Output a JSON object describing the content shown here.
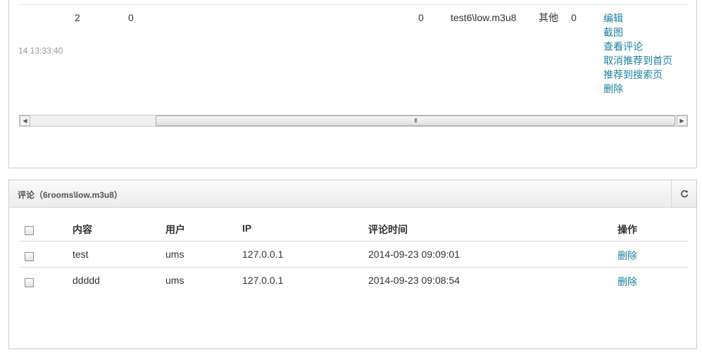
{
  "top_table": {
    "row": {
      "time_fragment": "14 13:33:40",
      "col_a": "2",
      "col_b": "0",
      "col_c": "0",
      "file": "test6\\low.m3u8",
      "category": "其他",
      "col_d": "0",
      "actions": [
        "编辑",
        "截图",
        "查看评论",
        "取消推荐到首页",
        "推荐到搜索页",
        "删除"
      ]
    },
    "scrollbar": {
      "grip": "III",
      "left_arrow": "◀",
      "right_arrow": "▶"
    }
  },
  "comments": {
    "title": "评论（6rooms\\low.m3u8）",
    "refresh_icon": "refresh-icon",
    "columns": [
      "内容",
      "用户",
      "IP",
      "评论时间",
      "操作"
    ],
    "rows": [
      {
        "content": "test",
        "user": "ums",
        "ip": "127.0.0.1",
        "time": "2014-09-23 09:09:01",
        "action": "删除"
      },
      {
        "content": "ddddd",
        "user": "ums",
        "ip": "127.0.0.1",
        "time": "2014-09-23 09:08:54",
        "action": "删除"
      }
    ]
  },
  "colors": {
    "link": "#1a81a0",
    "border": "#cccccc",
    "header_bg": "#ececec"
  }
}
